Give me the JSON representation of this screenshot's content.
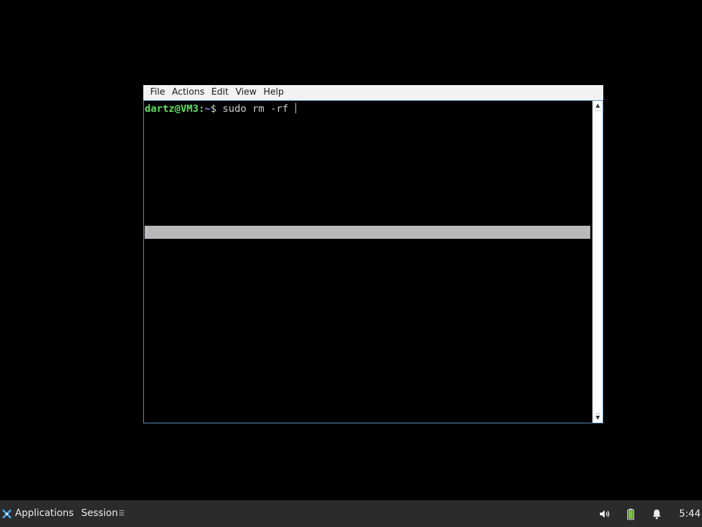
{
  "terminal": {
    "menu": [
      "File",
      "Actions",
      "Edit",
      "View",
      "Help"
    ],
    "prompt_user": "dartz@VM3",
    "prompt_sep": ":",
    "prompt_path": "~",
    "prompt_dollar": "$ ",
    "command": "sudo rm -rf "
  },
  "taskbar": {
    "applications_label": "Applications",
    "session_label": "Session",
    "clock": "5:44",
    "tray_icons": [
      "volume-icon",
      "battery-icon",
      "notification-bell-icon"
    ]
  },
  "colors": {
    "prompt_user": "#5fe05f",
    "prompt_path": "#6f8cff",
    "window_border": "#5b8fc7",
    "taskbar_bg": "#2b2b2b",
    "battery": "#7fc241",
    "xfce_logo": "#4aa3df"
  }
}
